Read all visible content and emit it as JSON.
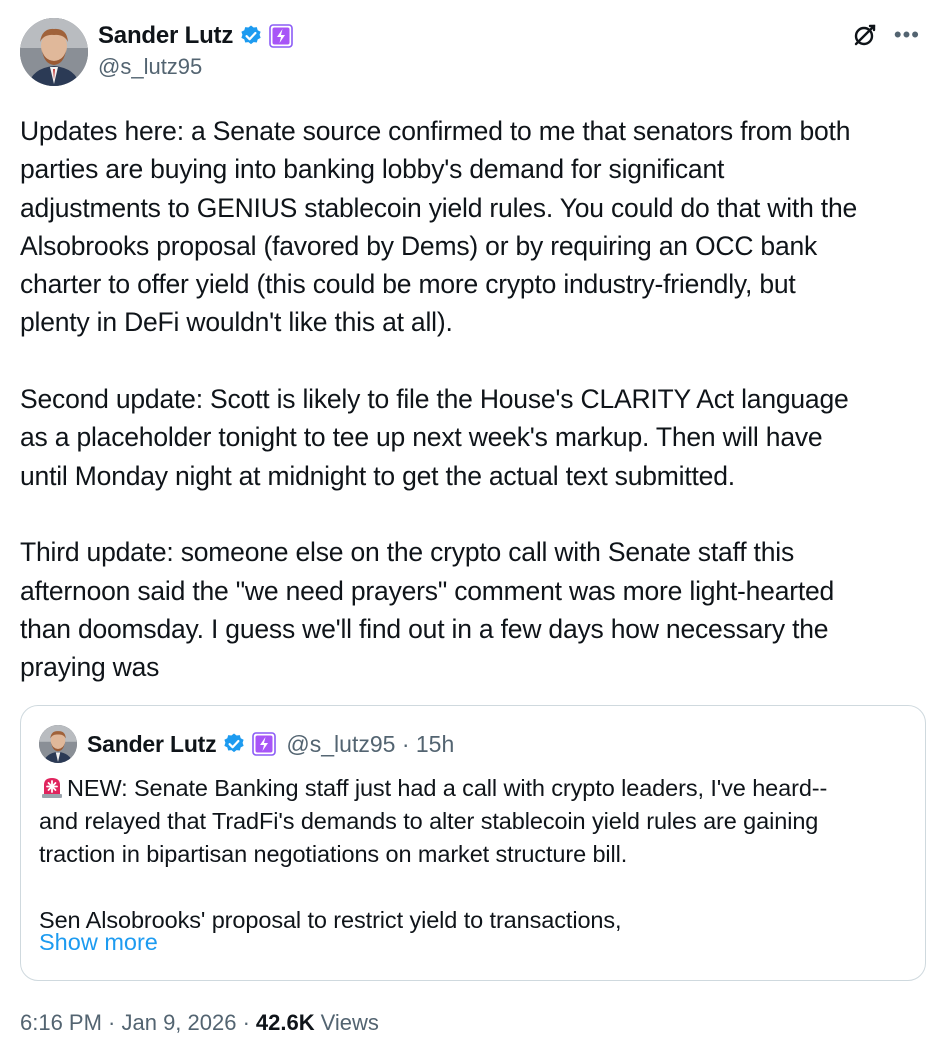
{
  "author": {
    "display_name": "Sander Lutz",
    "handle": "@s_lutz95"
  },
  "icons": {
    "verified": "verified-badge-icon",
    "affiliate": "affiliate-badge-icon",
    "grok": "grok-icon",
    "more": "more-options-icon",
    "siren": "rotating-light-emoji"
  },
  "colors": {
    "verified_blue": "#1d9bf0",
    "affiliate_purple": "#9b5cf6",
    "link_blue": "#1d9bf0",
    "secondary_text": "#536471"
  },
  "tweet": {
    "text": "Updates here: a Senate source confirmed to me that senators from both\nparties are buying into banking lobby's demand for significant\nadjustments to GENIUS stablecoin yield rules. You could do that with the\nAlsobrooks proposal (favored by Dems) or by requiring an OCC bank\ncharter to offer yield (this could be more crypto industry-friendly, but\nplenty in DeFi wouldn't like this at all).\n\nSecond update: Scott is likely to file the House's CLARITY Act language\nas a placeholder tonight to tee up next week's markup. Then will have\nuntil Monday night at midnight to get the actual text submitted.\n\nThird update: someone else on the crypto call with Senate staff this\nafternoon said the \"we need prayers\" comment was more light-hearted\nthan doomsday. I guess we'll find out in a few days how necessary the\npraying was"
  },
  "quote": {
    "display_name": "Sander Lutz",
    "meta": "@s_lutz95 · 15h",
    "text": "NEW: Senate Banking staff just had a call with crypto leaders, I've heard--\nand relayed that TradFi's demands to alter stablecoin yield rules are gaining\ntraction in bipartisan negotiations on market structure bill.\n\nSen Alsobrooks' proposal to restrict yield to transactions,",
    "show_more": "Show more"
  },
  "footer": {
    "timestamp": "6:16 PM · Jan 9, 2026 ·",
    "views_count": "42.6K",
    "views_label": "Views"
  }
}
